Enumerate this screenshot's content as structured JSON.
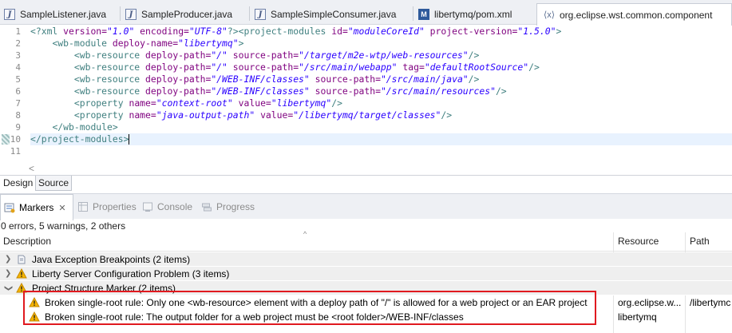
{
  "editor_tabs": [
    {
      "label": "SampleListener.java",
      "icon": "java-file-icon"
    },
    {
      "label": "SampleProducer.java",
      "icon": "java-file-icon"
    },
    {
      "label": "SampleSimpleConsumer.java",
      "icon": "java-file-icon"
    },
    {
      "label": "libertymq/pom.xml",
      "icon": "maven-pom-icon"
    },
    {
      "label": "org.eclipse.wst.common.component",
      "icon": "xml-file-icon",
      "active": true
    }
  ],
  "code": {
    "line_numbers": [
      "1",
      "2",
      "3",
      "4",
      "5",
      "6",
      "7",
      "8",
      "9",
      "10",
      "11"
    ],
    "xml_decl": {
      "open": "<?xml",
      "a1": " version=",
      "v1": "\"1.0\"",
      "a2": " encoding=",
      "v2": "\"UTF-8\"",
      "close": "?>"
    },
    "line1_tag": "<project-modules",
    "line1_a1": " id=",
    "line1_v1": "\"moduleCoreId\"",
    "line1_a2": " project-version=",
    "line1_v2": "\"1.5.0\"",
    "line1_end": ">",
    "line2_tag": "<wb-module",
    "line2_a1": " deploy-name=",
    "line2_v1": "\"libertymq\"",
    "line2_end": ">",
    "res_tag": "<wb-resource",
    "deploy_path_attr": " deploy-path=",
    "source_path_attr": " source-path=",
    "tag_attr": " tag=",
    "self_close": "/>",
    "line3_v1": "\"/\"",
    "line3_v2": "\"/target/m2e-wtp/web-resources\"",
    "line4_v1": "\"/\"",
    "line4_v2": "\"/src/main/webapp\"",
    "line4_v3": "\"defaultRootSource\"",
    "line5_v1": "\"/WEB-INF/classes\"",
    "line5_v2": "\"/src/main/java\"",
    "line6_v1": "\"/WEB-INF/classes\"",
    "line6_v2": "\"/src/main/resources\"",
    "prop_tag": "<property",
    "name_attr": " name=",
    "value_attr": " value=",
    "line7_v1": "\"context-root\"",
    "line7_v2": "\"libertymq\"",
    "line8_v1": "\"java-output-path\"",
    "line8_v2": "\"/libertymq/target/classes\"",
    "line9_tag": "</wb-module",
    "line10_tag": "</project-modules",
    "gt": ">",
    "scroll_glyph": "<"
  },
  "sub_tabs": {
    "design": "Design",
    "source": "Source"
  },
  "view_tabs": [
    {
      "label": "Markers",
      "icon": "markers-icon",
      "active": true
    },
    {
      "label": "Properties",
      "icon": "properties-icon"
    },
    {
      "label": "Console",
      "icon": "console-icon"
    },
    {
      "label": "Progress",
      "icon": "progress-icon"
    }
  ],
  "markers": {
    "summary": "0 errors, 5 warnings, 2 others",
    "columns": {
      "description": "Description",
      "resource": "Resource",
      "path": "Path",
      "sort_glyph": "^"
    },
    "groups": [
      {
        "label": "Java Exception Breakpoints (2 items)",
        "icon": "breakpoint-icon",
        "expanded": false
      },
      {
        "label": "Liberty Server Configuration Problem (3 items)",
        "icon": "warning-icon",
        "expanded": false
      },
      {
        "label": "Project Structure Marker (2 items)",
        "icon": "warning-icon",
        "expanded": true
      }
    ],
    "rows": [
      {
        "description": "Broken single-root rule: Only one <wb-resource> element with a deploy path of \"/\" is allowed for a web project or an EAR project",
        "resource": "org.eclipse.w...",
        "path": "/libertymc"
      },
      {
        "description": "Broken single-root rule: The output folder for a web project must be <root folder>/WEB-INF/classes",
        "resource": "libertymq",
        "path": ""
      }
    ]
  },
  "colors": {
    "tag": "#3f7f7f",
    "attr": "#7f007f",
    "value": "#2a00ff",
    "highlight_box": "#e0191f",
    "warning": "#f5b400"
  }
}
